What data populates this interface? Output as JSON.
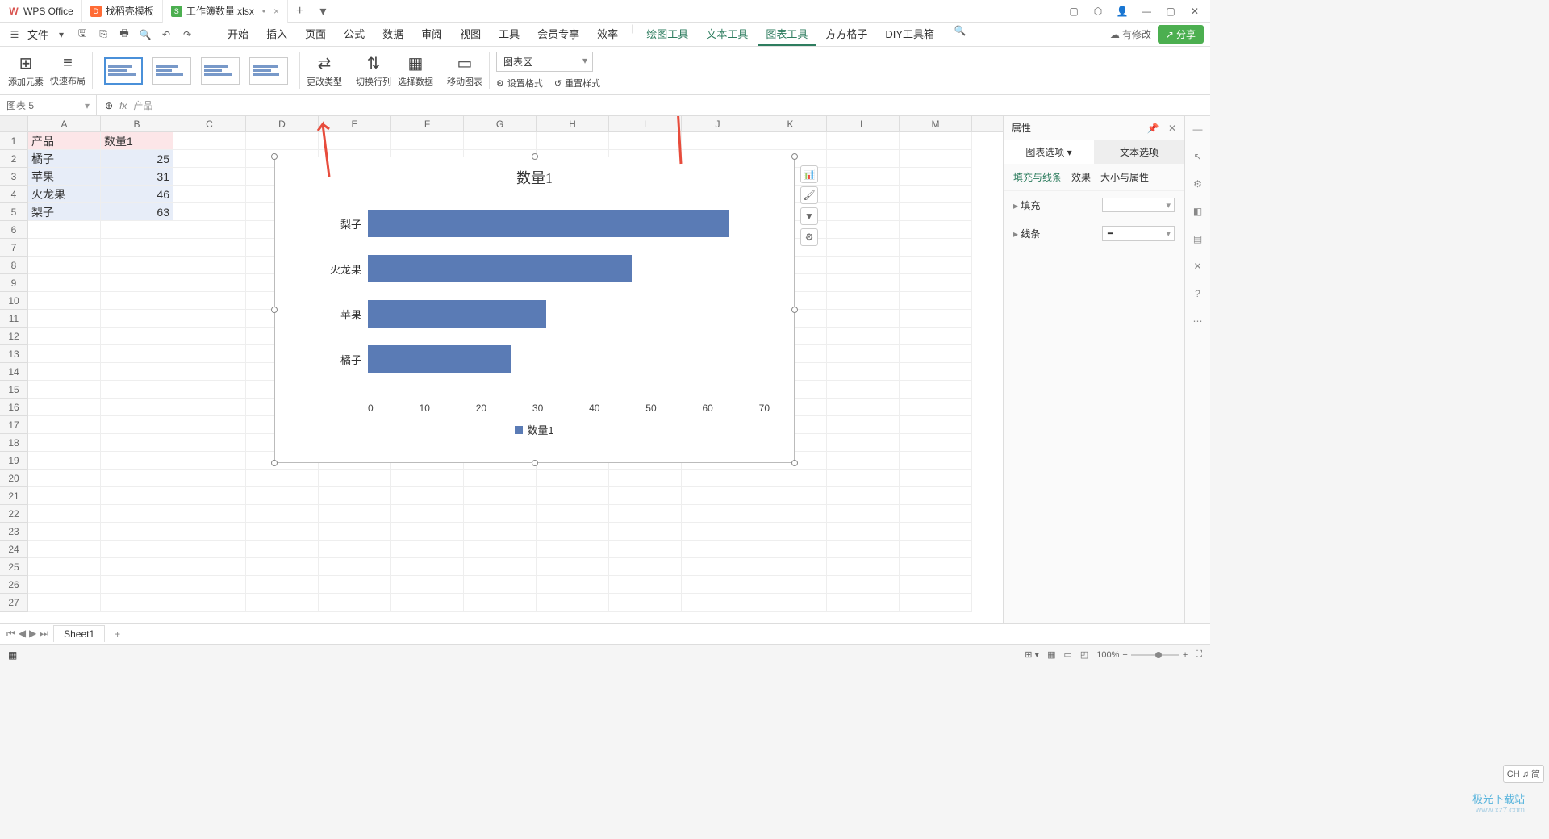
{
  "titlebar": {
    "tabs": [
      {
        "icon": "wps",
        "label": "WPS Office"
      },
      {
        "icon": "doc",
        "label": "找稻壳模板"
      },
      {
        "icon": "sheet",
        "label": "工作簿数量.xlsx",
        "dirty": "•"
      }
    ]
  },
  "menubar": {
    "file": "文件",
    "tabs": [
      "开始",
      "插入",
      "页面",
      "公式",
      "数据",
      "审阅",
      "视图",
      "工具",
      "会员专享",
      "效率"
    ],
    "tool_tabs": [
      "绘图工具",
      "文本工具",
      "图表工具",
      "方方格子",
      "DIY工具箱"
    ],
    "active_tab": "图表工具",
    "modify": "有修改",
    "share": "分享"
  },
  "ribbon": {
    "add_element": "添加元素",
    "quick_layout": "快速布局",
    "change_type": "更改类型",
    "switch_rc": "切换行列",
    "select_data": "选择数据",
    "move_chart": "移动图表",
    "area_select": "图表区",
    "set_format": "设置格式",
    "reset_style": "重置样式"
  },
  "namebox": "图表 5",
  "formula": "产品",
  "columns": [
    "A",
    "B",
    "C",
    "D",
    "E",
    "F",
    "G",
    "H",
    "I",
    "J",
    "K",
    "L",
    "M"
  ],
  "cells": {
    "A1": "产品",
    "B1": "数量1",
    "A2": "橘子",
    "B2": "25",
    "A3": "苹果",
    "B3": "31",
    "A4": "火龙果",
    "B4": "46",
    "A5": "梨子",
    "B5": "63"
  },
  "chart_data": {
    "type": "bar",
    "title": "数量1",
    "categories": [
      "梨子",
      "火龙果",
      "苹果",
      "橘子"
    ],
    "values": [
      63,
      46,
      31,
      25
    ],
    "x_ticks": [
      "0",
      "10",
      "20",
      "30",
      "40",
      "50",
      "60",
      "70"
    ],
    "xlim": [
      0,
      70
    ],
    "legend": "数量1"
  },
  "panel": {
    "title": "属性",
    "tab_chart": "图表选项",
    "tab_text": "文本选项",
    "sub_fill": "填充与线条",
    "sub_effect": "效果",
    "sub_size": "大小与属性",
    "fill": "填充",
    "line": "线条"
  },
  "sheet": {
    "name": "Sheet1"
  },
  "status": {
    "zoom": "100%",
    "ime": "CH ♫ 简"
  },
  "watermark": {
    "l1": "极光下载站",
    "l2": "www.xz7.com"
  }
}
